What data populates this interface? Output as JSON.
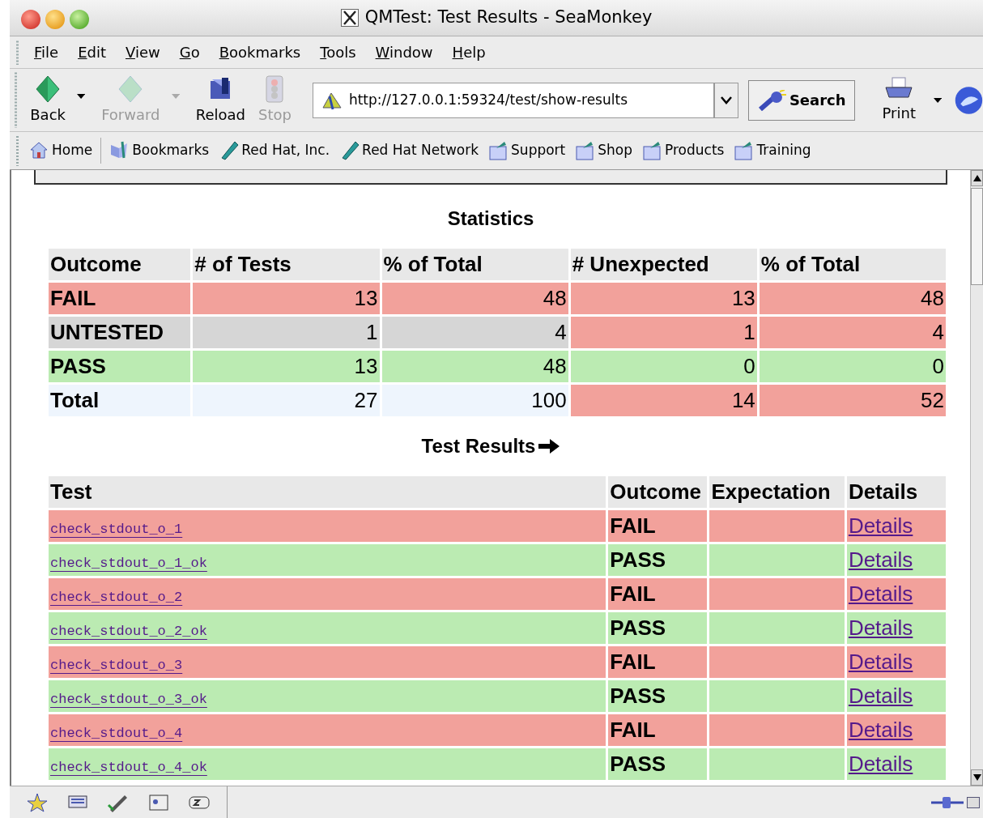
{
  "window": {
    "title": "QMTest: Test Results - SeaMonkey"
  },
  "menu": [
    "File",
    "Edit",
    "View",
    "Go",
    "Bookmarks",
    "Tools",
    "Window",
    "Help"
  ],
  "nav_toolbar": {
    "buttons": [
      {
        "label": "Back",
        "kind": "back",
        "disabled": false,
        "dropdown": true
      },
      {
        "label": "Forward",
        "kind": "forward",
        "disabled": true,
        "dropdown": true
      },
      {
        "label": "Reload",
        "kind": "reload",
        "disabled": false,
        "dropdown": false
      },
      {
        "label": "Stop",
        "kind": "stop",
        "disabled": true,
        "dropdown": false
      }
    ],
    "url": "http://127.0.0.1:59324/test/show-results",
    "search": "Search",
    "print": "Print"
  },
  "personal_toolbar": [
    {
      "label": "Home",
      "kind": "home"
    },
    {
      "label": "Bookmarks",
      "kind": "bookmarks"
    },
    {
      "label": "Red Hat, Inc.",
      "kind": "link"
    },
    {
      "label": "Red Hat Network",
      "kind": "link"
    },
    {
      "label": "Support",
      "kind": "folder"
    },
    {
      "label": "Shop",
      "kind": "folder"
    },
    {
      "label": "Products",
      "kind": "folder"
    },
    {
      "label": "Training",
      "kind": "folder"
    }
  ],
  "statistics": {
    "title": "Statistics",
    "columns": [
      "Outcome",
      "# of Tests",
      "% of Total",
      "# Unexpected",
      "% of Total"
    ],
    "rows": [
      {
        "cells": [
          {
            "text": "FAIL",
            "color": "#f2a19b"
          },
          {
            "text": "13",
            "color": "#f2a19b"
          },
          {
            "text": "48",
            "color": "#f2a19b"
          },
          {
            "text": "13",
            "color": "#f2a19b"
          },
          {
            "text": "48",
            "color": "#f2a19b"
          }
        ]
      },
      {
        "cells": [
          {
            "text": "UNTESTED",
            "color": "#d6d6d6"
          },
          {
            "text": "1",
            "color": "#d6d6d6"
          },
          {
            "text": "4",
            "color": "#d6d6d6"
          },
          {
            "text": "1",
            "color": "#f2a19b"
          },
          {
            "text": "4",
            "color": "#f2a19b"
          }
        ]
      },
      {
        "cells": [
          {
            "text": "PASS",
            "color": "#bbebb2"
          },
          {
            "text": "13",
            "color": "#bbebb2"
          },
          {
            "text": "48",
            "color": "#bbebb2"
          },
          {
            "text": "0",
            "color": "#bbebb2"
          },
          {
            "text": "0",
            "color": "#bbebb2"
          }
        ]
      },
      {
        "cells": [
          {
            "text": "Total",
            "color": "#eef5fd"
          },
          {
            "text": "27",
            "color": "#eef5fd"
          },
          {
            "text": "100",
            "color": "#eef5fd"
          },
          {
            "text": "14",
            "color": "#f2a19b"
          },
          {
            "text": "52",
            "color": "#f2a19b"
          }
        ]
      }
    ]
  },
  "results": {
    "title": "Test Results",
    "columns": [
      "Test",
      "Outcome",
      "Expectation",
      "Details"
    ],
    "rows": [
      {
        "test": "check_stdout_o_1",
        "outcome": "FAIL",
        "color": "#f2a19b",
        "details": "Details"
      },
      {
        "test": "check_stdout_o_1_ok",
        "outcome": "PASS",
        "color": "#bbebb2",
        "details": "Details"
      },
      {
        "test": "check_stdout_o_2",
        "outcome": "FAIL",
        "color": "#f2a19b",
        "details": "Details"
      },
      {
        "test": "check_stdout_o_2_ok",
        "outcome": "PASS",
        "color": "#bbebb2",
        "details": "Details"
      },
      {
        "test": "check_stdout_o_3",
        "outcome": "FAIL",
        "color": "#f2a19b",
        "details": "Details"
      },
      {
        "test": "check_stdout_o_3_ok",
        "outcome": "PASS",
        "color": "#bbebb2",
        "details": "Details"
      },
      {
        "test": "check_stdout_o_4",
        "outcome": "FAIL",
        "color": "#f2a19b",
        "details": "Details"
      },
      {
        "test": "check_stdout_o_4_ok",
        "outcome": "PASS",
        "color": "#bbebb2",
        "details": "Details"
      }
    ]
  }
}
